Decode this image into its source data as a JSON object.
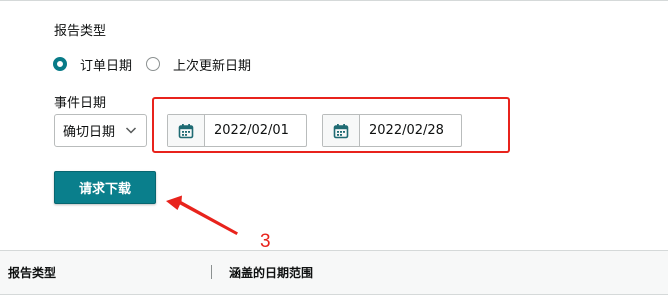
{
  "form": {
    "report_type_label": "报告类型",
    "radio_options": [
      {
        "label": "订单日期",
        "checked": true
      },
      {
        "label": "上次更新日期",
        "checked": false
      }
    ],
    "event_date_label": "事件日期",
    "date_mode_select": "确切日期",
    "start_date": "2022/02/01",
    "end_date": "2022/02/28",
    "submit_label": "请求下载"
  },
  "annotation": {
    "step_number": "3",
    "color": "#e8231c"
  },
  "table": {
    "columns": [
      "报告类型",
      "涵盖的日期范围"
    ]
  },
  "colors": {
    "accent": "#0a7f8c",
    "border": "#b9bcbc"
  },
  "icons": {
    "date_picker": "calendar-icon",
    "select": "chevron-down-icon"
  }
}
